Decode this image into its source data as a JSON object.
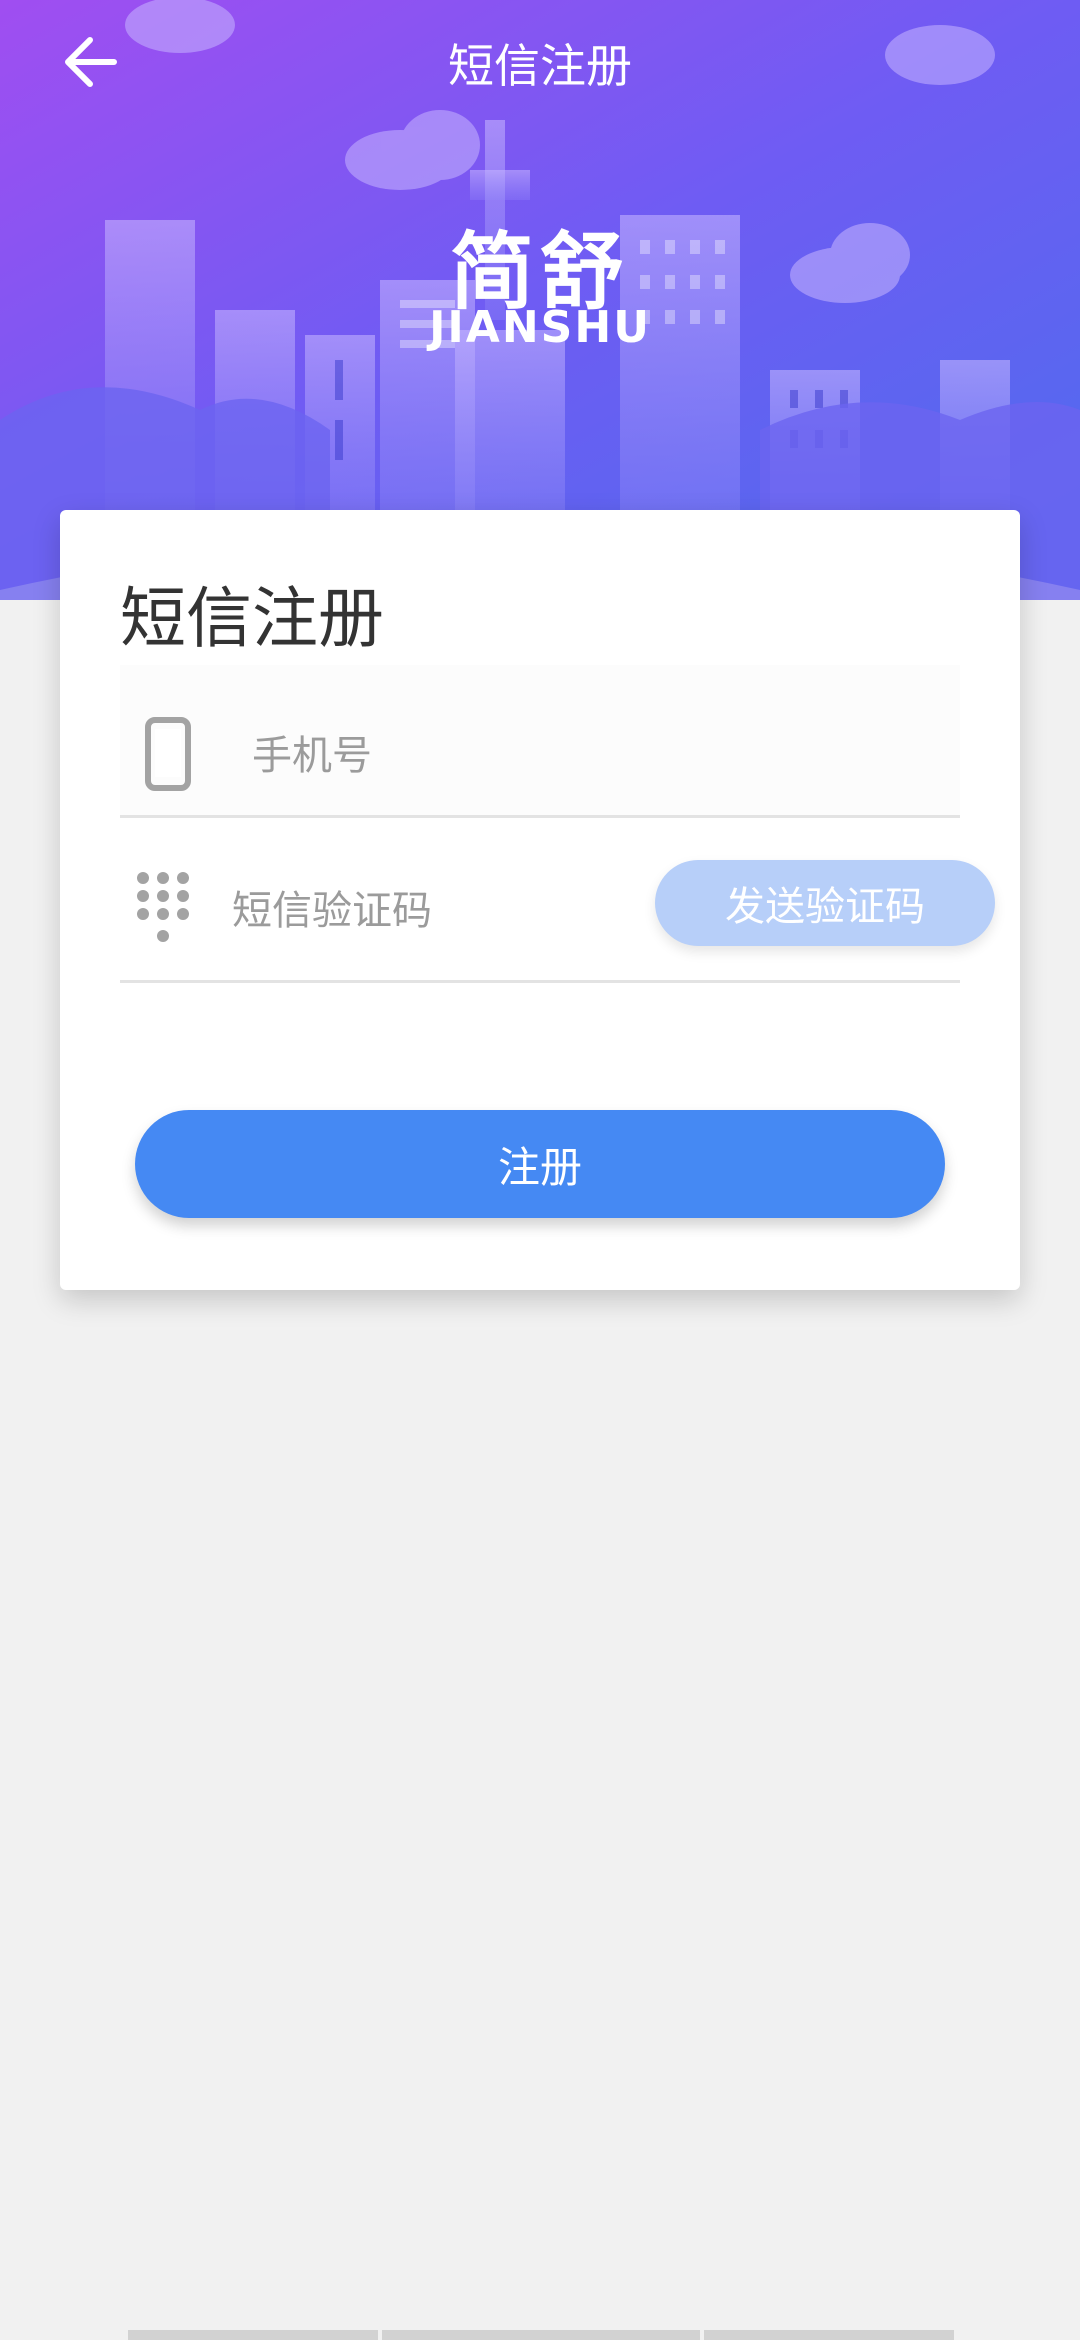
{
  "header": {
    "title": "短信注册",
    "logo_cn": "简舒",
    "logo_en": "JIANSHU",
    "back_icon": "arrow-left-icon"
  },
  "form": {
    "title": "短信注册",
    "phone": {
      "placeholder": "手机号",
      "value": "",
      "icon": "phone-icon"
    },
    "code": {
      "placeholder": "短信验证码",
      "value": "",
      "icon": "keypad-icon"
    },
    "send_code_label": "发送验证码",
    "register_label": "注册"
  },
  "colors": {
    "header_gradient_start": "#9b4cf0",
    "header_gradient_end": "#4d6bef",
    "primary_button": "#4589f3",
    "send_button_disabled": "#b7cff9",
    "page_background": "#f1f1f1"
  }
}
